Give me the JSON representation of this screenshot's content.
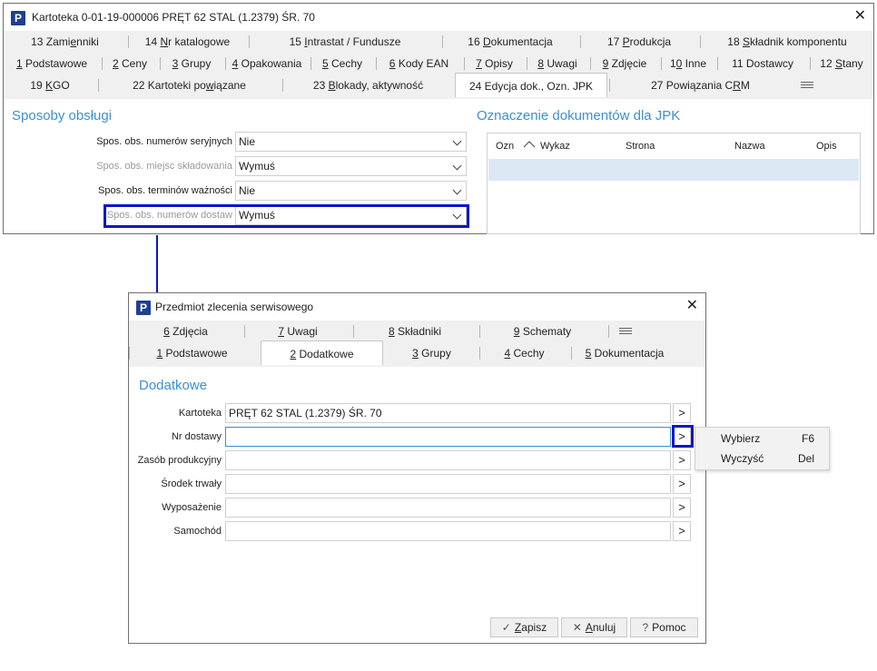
{
  "window1": {
    "title": "Kartoteka 0-01-19-000006 PRĘT 62 STAL (1.2379) ŚR. 70",
    "tabs_row1": [
      {
        "pre": "13 Zami",
        "u": "e",
        "post": "nniki"
      },
      {
        "pre": "14 ",
        "u": "N",
        "post": "r katalogowe"
      },
      {
        "pre": "15 ",
        "u": "I",
        "post": "ntrastat / Fundusze"
      },
      {
        "pre": "16 ",
        "u": "D",
        "post": "okumentacja"
      },
      {
        "pre": "17 ",
        "u": "P",
        "post": "rodukcja"
      },
      {
        "pre": "18 ",
        "u": "S",
        "post": "kładnik komponentu"
      }
    ],
    "tabs_row2": [
      {
        "pre": "",
        "u": "1",
        "post": " Podstawowe"
      },
      {
        "pre": "",
        "u": "2",
        "post": " Ceny"
      },
      {
        "pre": "",
        "u": "3",
        "post": " Grupy"
      },
      {
        "pre": "",
        "u": "4",
        "post": " Opakowania"
      },
      {
        "pre": "",
        "u": "5",
        "post": " Cechy"
      },
      {
        "pre": "",
        "u": "6",
        "post": " Kody EAN"
      },
      {
        "pre": "",
        "u": "7",
        "post": " Opisy"
      },
      {
        "pre": "",
        "u": "8",
        "post": " Uwagi"
      },
      {
        "pre": "",
        "u": "9",
        "post": " Zdjęcie"
      },
      {
        "pre": "1",
        "u": "0",
        "post": " Inne"
      },
      {
        "pre": "11 Dostawcy",
        "u": "",
        "post": ""
      },
      {
        "pre": "12 ",
        "u": "S",
        "post": "tany"
      }
    ],
    "tabs_row3": [
      {
        "pre": "19 ",
        "u": "K",
        "post": "GO"
      },
      {
        "pre": "22 Kartoteki po",
        "u": "w",
        "post": "iązane"
      },
      {
        "pre": "23 ",
        "u": "B",
        "post": "lokady, aktywność"
      },
      {
        "pre": "24 Edycja dok., Ozn. JPK",
        "u": "",
        "post": ""
      },
      {
        "pre": "27 Powiązania C",
        "u": "R",
        "post": "M"
      }
    ],
    "section_left": "Sposoby obsługi",
    "section_right": "Oznaczenie dokumentów dla JPK",
    "rows": [
      {
        "label": "Spos. obs. numerów seryjnych",
        "value": "Nie",
        "dim": false
      },
      {
        "label": "Spos. obs. miejsc składowania",
        "value": "Wymuś",
        "dim": true
      },
      {
        "label": "Spos. obs. terminów ważności",
        "value": "Nie",
        "dim": false
      },
      {
        "label": "Spos. obs. numerów dostaw",
        "value": "Wymuś",
        "dim": true
      }
    ],
    "grid_columns": [
      "Ozn",
      "Wykaz",
      "Strona",
      "Nazwa",
      "Opis"
    ]
  },
  "window2": {
    "title": "Przedmiot zlecenia serwisowego",
    "tabs_row1": [
      {
        "pre": "",
        "u": "6",
        "post": " Zdjęcia"
      },
      {
        "pre": "",
        "u": "7",
        "post": " Uwagi"
      },
      {
        "pre": "",
        "u": "8",
        "post": " Składniki"
      },
      {
        "pre": "",
        "u": "9",
        "post": " Schematy"
      }
    ],
    "tabs_row2": [
      {
        "pre": "",
        "u": "1",
        "post": " Podstawowe"
      },
      {
        "pre": "",
        "u": "2",
        "post": " Dodatkowe"
      },
      {
        "pre": "",
        "u": "3",
        "post": " Grupy"
      },
      {
        "pre": "",
        "u": "4",
        "post": " Cechy"
      },
      {
        "pre": "",
        "u": "5",
        "post": " Dokumentacja"
      }
    ],
    "section": "Dodatkowe",
    "fields": [
      {
        "label": "Kartoteka",
        "value": "PRĘT 62 STAL (1.2379) ŚR. 70",
        "button": ">"
      },
      {
        "label": "Nr dostawy",
        "value": "",
        "button": ">"
      },
      {
        "label": "Zasób produkcyjny",
        "value": "",
        "button": ">"
      },
      {
        "label": "Środek trwały",
        "value": "",
        "button": ">"
      },
      {
        "label": "Wyposażenie",
        "value": "",
        "button": ">"
      },
      {
        "label": "Samochód",
        "value": "",
        "button": ">"
      }
    ],
    "context_menu": [
      {
        "label": "Wybierz",
        "key": "F6"
      },
      {
        "label": "Wyczyść",
        "key": "Del"
      }
    ],
    "buttons": {
      "save": {
        "pre": "",
        "u": "Z",
        "post": "apisz"
      },
      "cancel": {
        "pre": "",
        "u": "A",
        "post": "nuluj"
      },
      "help": {
        "pre": "Pomoc",
        "u": "",
        "post": ""
      }
    },
    "icons": {
      "save": "✓",
      "cancel": "✕",
      "help": "?"
    }
  },
  "colors": {
    "highlight": "#0a16c8",
    "section": "#3d8fd1",
    "selected_row": "#dce9f5"
  },
  "app_icon_letter": "P",
  "close_glyph": "✕"
}
